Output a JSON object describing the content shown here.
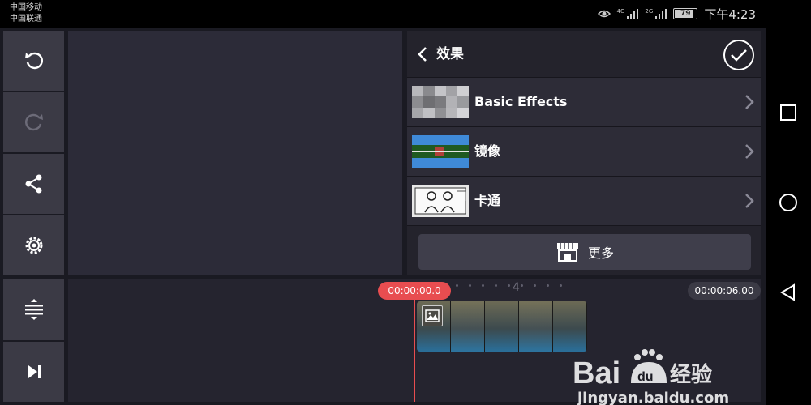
{
  "status_bar": {
    "carrier1": "中国移动",
    "carrier2": "中国联通",
    "signal1_label": "4G",
    "signal2_label": "2G",
    "battery": "79",
    "time": "下午4:23"
  },
  "toolbar": {
    "undo_icon": "undo-icon",
    "redo_icon": "redo-icon",
    "share_icon": "share-icon",
    "settings_icon": "settings-icon",
    "adjust_icon": "adjust-height-icon",
    "jump_end_icon": "skip-to-end-icon"
  },
  "panel": {
    "title": "效果",
    "items": [
      {
        "label": "Basic Effects"
      },
      {
        "label": "镜像"
      },
      {
        "label": "卡通"
      }
    ],
    "more_label": "更多"
  },
  "timeline": {
    "start_time": "00:00:00.0",
    "end_time": "00:00:06.00",
    "tick_number": "4"
  },
  "watermark": {
    "brand": "Baidu经验",
    "url": "jingyan.baidu.com"
  },
  "colors": {
    "accent": "#e84d50",
    "panel_bg": "#24232c",
    "button_bg": "#3b3a45"
  }
}
